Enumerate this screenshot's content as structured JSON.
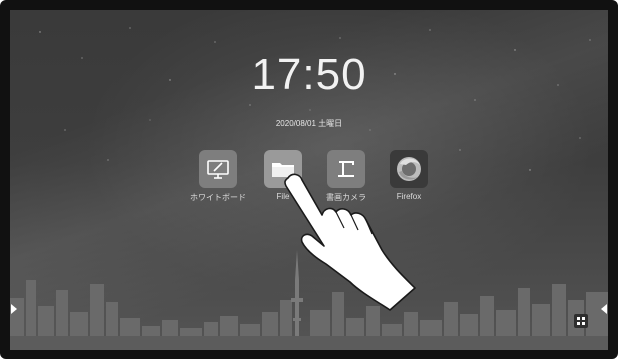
{
  "home": {
    "time": "17:50",
    "date": "2020/08/01 土曜日"
  },
  "apps": [
    {
      "label": "ホワイトボード",
      "icon": "whiteboard-icon"
    },
    {
      "label": "File",
      "icon": "folder-icon"
    },
    {
      "label": "書画カメラ",
      "icon": "document-camera-icon"
    },
    {
      "label": "Firefox",
      "icon": "firefox-icon"
    }
  ],
  "controls": {
    "left_handle_icon": "chevron-right-icon",
    "right_handle_icon": "chevron-left-icon",
    "corner_icon": "app-grid-icon"
  }
}
